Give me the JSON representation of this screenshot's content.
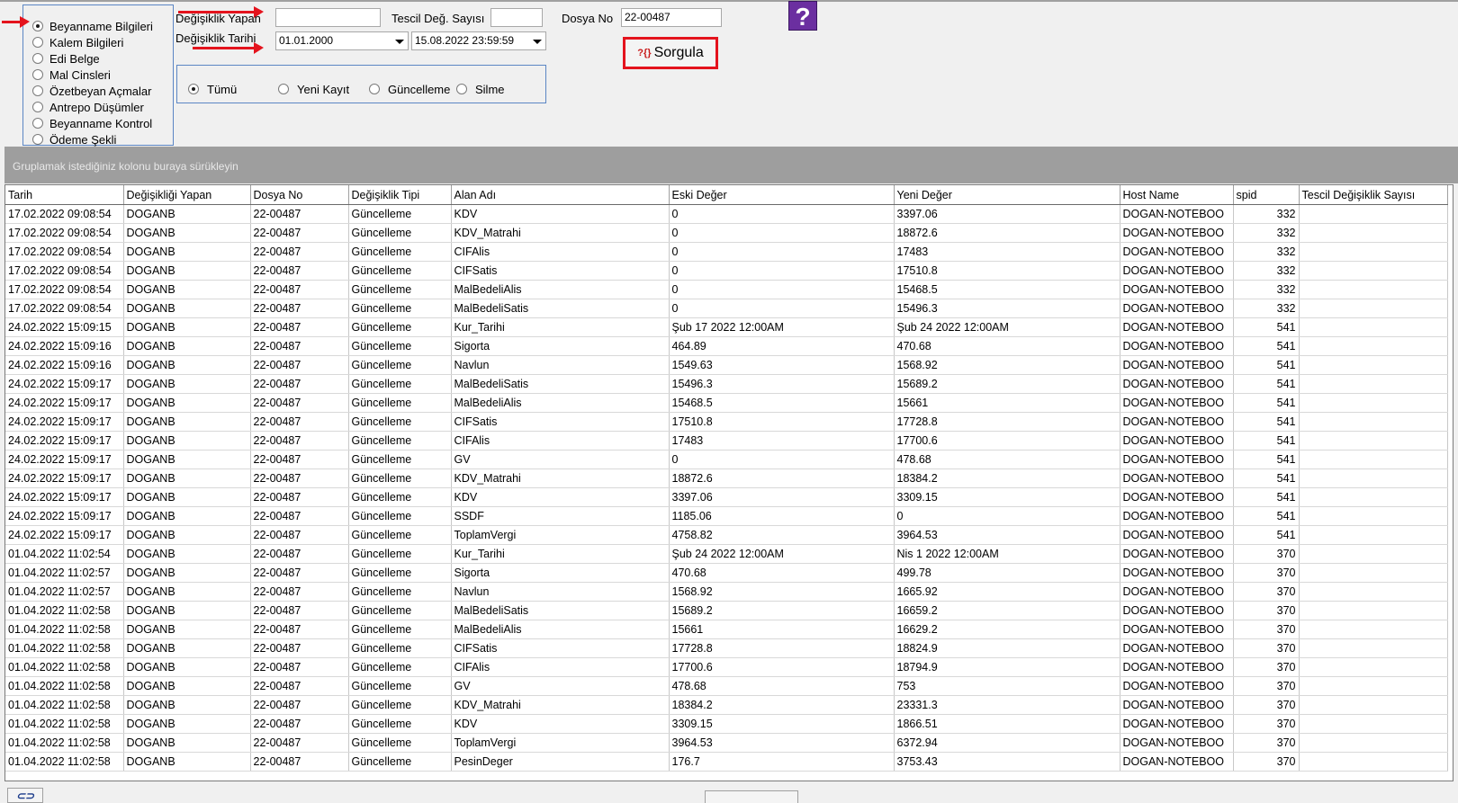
{
  "radio_options": [
    {
      "label": "Beyanname Bilgileri",
      "checked": true
    },
    {
      "label": "Kalem Bilgileri",
      "checked": false
    },
    {
      "label": "Edi Belge",
      "checked": false
    },
    {
      "label": "Mal Cinsleri",
      "checked": false
    },
    {
      "label": "Özetbeyan Açmalar",
      "checked": false
    },
    {
      "label": "Antrepo Düşümler",
      "checked": false
    },
    {
      "label": "Beyanname Kontrol",
      "checked": false
    },
    {
      "label": "Ödeme Şekli",
      "checked": false
    }
  ],
  "form": {
    "degisiklik_yapan_label": "Değişiklik Yapan",
    "degisiklik_yapan_value": "",
    "tescil_label": "Tescil Değ. Sayısı",
    "tescil_value": "",
    "dosya_no_label": "Dosya No",
    "dosya_no_value": "22-00487",
    "degisiklik_tarihi_label": "Değişiklik Tarihi",
    "date_from": "01.01.2000",
    "date_to": "15.08.2022 23:59:59"
  },
  "filter_options": [
    {
      "label": "Tümü",
      "checked": true
    },
    {
      "label": "Yeni Kayıt",
      "checked": false
    },
    {
      "label": "Güncelleme",
      "checked": false
    },
    {
      "label": "Silme",
      "checked": false
    }
  ],
  "buttons": {
    "sorgula_icon": "?{}",
    "sorgula_label": "Sorgula",
    "help_label": "?"
  },
  "annotation_color": "#e4131d",
  "group_bar_text": "Gruplamak istediğiniz kolonu buraya sürükleyin",
  "grid": {
    "columns": [
      "Tarih",
      "Değişikliği Yapan",
      "Dosya No",
      "Değişiklik Tipi",
      "Alan Adı",
      "Eski Değer",
      "Yeni Değer",
      "Host Name",
      "spid",
      "Tescil Değişiklik Sayısı"
    ],
    "rows": [
      [
        "17.02.2022 09:08:54",
        "DOGANB",
        "22-00487",
        "Güncelleme",
        "KDV",
        "0",
        "3397.06",
        "DOGAN-NOTEBOO",
        "332",
        ""
      ],
      [
        "17.02.2022 09:08:54",
        "DOGANB",
        "22-00487",
        "Güncelleme",
        "KDV_Matrahi",
        "0",
        "18872.6",
        "DOGAN-NOTEBOO",
        "332",
        ""
      ],
      [
        "17.02.2022 09:08:54",
        "DOGANB",
        "22-00487",
        "Güncelleme",
        "CIFAlis",
        "0",
        "17483",
        "DOGAN-NOTEBOO",
        "332",
        ""
      ],
      [
        "17.02.2022 09:08:54",
        "DOGANB",
        "22-00487",
        "Güncelleme",
        "CIFSatis",
        "0",
        "17510.8",
        "DOGAN-NOTEBOO",
        "332",
        ""
      ],
      [
        "17.02.2022 09:08:54",
        "DOGANB",
        "22-00487",
        "Güncelleme",
        "MalBedeliAlis",
        "0",
        "15468.5",
        "DOGAN-NOTEBOO",
        "332",
        ""
      ],
      [
        "17.02.2022 09:08:54",
        "DOGANB",
        "22-00487",
        "Güncelleme",
        "MalBedeliSatis",
        "0",
        "15496.3",
        "DOGAN-NOTEBOO",
        "332",
        ""
      ],
      [
        "24.02.2022 15:09:15",
        "DOGANB",
        "22-00487",
        "Güncelleme",
        "Kur_Tarihi",
        "Şub 17 2022 12:00AM",
        "Şub 24 2022 12:00AM",
        "DOGAN-NOTEBOO",
        "541",
        ""
      ],
      [
        "24.02.2022 15:09:16",
        "DOGANB",
        "22-00487",
        "Güncelleme",
        "Sigorta",
        "464.89",
        "470.68",
        "DOGAN-NOTEBOO",
        "541",
        ""
      ],
      [
        "24.02.2022 15:09:16",
        "DOGANB",
        "22-00487",
        "Güncelleme",
        "Navlun",
        "1549.63",
        "1568.92",
        "DOGAN-NOTEBOO",
        "541",
        ""
      ],
      [
        "24.02.2022 15:09:17",
        "DOGANB",
        "22-00487",
        "Güncelleme",
        "MalBedeliSatis",
        "15496.3",
        "15689.2",
        "DOGAN-NOTEBOO",
        "541",
        ""
      ],
      [
        "24.02.2022 15:09:17",
        "DOGANB",
        "22-00487",
        "Güncelleme",
        "MalBedeliAlis",
        "15468.5",
        "15661",
        "DOGAN-NOTEBOO",
        "541",
        ""
      ],
      [
        "24.02.2022 15:09:17",
        "DOGANB",
        "22-00487",
        "Güncelleme",
        "CIFSatis",
        "17510.8",
        "17728.8",
        "DOGAN-NOTEBOO",
        "541",
        ""
      ],
      [
        "24.02.2022 15:09:17",
        "DOGANB",
        "22-00487",
        "Güncelleme",
        "CIFAlis",
        "17483",
        "17700.6",
        "DOGAN-NOTEBOO",
        "541",
        ""
      ],
      [
        "24.02.2022 15:09:17",
        "DOGANB",
        "22-00487",
        "Güncelleme",
        "GV",
        "0",
        "478.68",
        "DOGAN-NOTEBOO",
        "541",
        ""
      ],
      [
        "24.02.2022 15:09:17",
        "DOGANB",
        "22-00487",
        "Güncelleme",
        "KDV_Matrahi",
        "18872.6",
        "18384.2",
        "DOGAN-NOTEBOO",
        "541",
        ""
      ],
      [
        "24.02.2022 15:09:17",
        "DOGANB",
        "22-00487",
        "Güncelleme",
        "KDV",
        "3397.06",
        "3309.15",
        "DOGAN-NOTEBOO",
        "541",
        ""
      ],
      [
        "24.02.2022 15:09:17",
        "DOGANB",
        "22-00487",
        "Güncelleme",
        "SSDF",
        "1185.06",
        "0",
        "DOGAN-NOTEBOO",
        "541",
        ""
      ],
      [
        "24.02.2022 15:09:17",
        "DOGANB",
        "22-00487",
        "Güncelleme",
        "ToplamVergi",
        "4758.82",
        "3964.53",
        "DOGAN-NOTEBOO",
        "541",
        ""
      ],
      [
        "01.04.2022 11:02:54",
        "DOGANB",
        "22-00487",
        "Güncelleme",
        "Kur_Tarihi",
        "Şub 24 2022 12:00AM",
        "Nis  1 2022 12:00AM",
        "DOGAN-NOTEBOO",
        "370",
        ""
      ],
      [
        "01.04.2022 11:02:57",
        "DOGANB",
        "22-00487",
        "Güncelleme",
        "Sigorta",
        "470.68",
        "499.78",
        "DOGAN-NOTEBOO",
        "370",
        ""
      ],
      [
        "01.04.2022 11:02:57",
        "DOGANB",
        "22-00487",
        "Güncelleme",
        "Navlun",
        "1568.92",
        "1665.92",
        "DOGAN-NOTEBOO",
        "370",
        ""
      ],
      [
        "01.04.2022 11:02:58",
        "DOGANB",
        "22-00487",
        "Güncelleme",
        "MalBedeliSatis",
        "15689.2",
        "16659.2",
        "DOGAN-NOTEBOO",
        "370",
        ""
      ],
      [
        "01.04.2022 11:02:58",
        "DOGANB",
        "22-00487",
        "Güncelleme",
        "MalBedeliAlis",
        "15661",
        "16629.2",
        "DOGAN-NOTEBOO",
        "370",
        ""
      ],
      [
        "01.04.2022 11:02:58",
        "DOGANB",
        "22-00487",
        "Güncelleme",
        "CIFSatis",
        "17728.8",
        "18824.9",
        "DOGAN-NOTEBOO",
        "370",
        ""
      ],
      [
        "01.04.2022 11:02:58",
        "DOGANB",
        "22-00487",
        "Güncelleme",
        "CIFAlis",
        "17700.6",
        "18794.9",
        "DOGAN-NOTEBOO",
        "370",
        ""
      ],
      [
        "01.04.2022 11:02:58",
        "DOGANB",
        "22-00487",
        "Güncelleme",
        "GV",
        "478.68",
        "753",
        "DOGAN-NOTEBOO",
        "370",
        ""
      ],
      [
        "01.04.2022 11:02:58",
        "DOGANB",
        "22-00487",
        "Güncelleme",
        "KDV_Matrahi",
        "18384.2",
        "23331.3",
        "DOGAN-NOTEBOO",
        "370",
        ""
      ],
      [
        "01.04.2022 11:02:58",
        "DOGANB",
        "22-00487",
        "Güncelleme",
        "KDV",
        "3309.15",
        "1866.51",
        "DOGAN-NOTEBOO",
        "370",
        ""
      ],
      [
        "01.04.2022 11:02:58",
        "DOGANB",
        "22-00487",
        "Güncelleme",
        "ToplamVergi",
        "3964.53",
        "6372.94",
        "DOGAN-NOTEBOO",
        "370",
        ""
      ],
      [
        "01.04.2022 11:02:58",
        "DOGANB",
        "22-00487",
        "Güncelleme",
        "PesinDeger",
        "176.7",
        "3753.43",
        "DOGAN-NOTEBOO",
        "370",
        ""
      ]
    ]
  }
}
